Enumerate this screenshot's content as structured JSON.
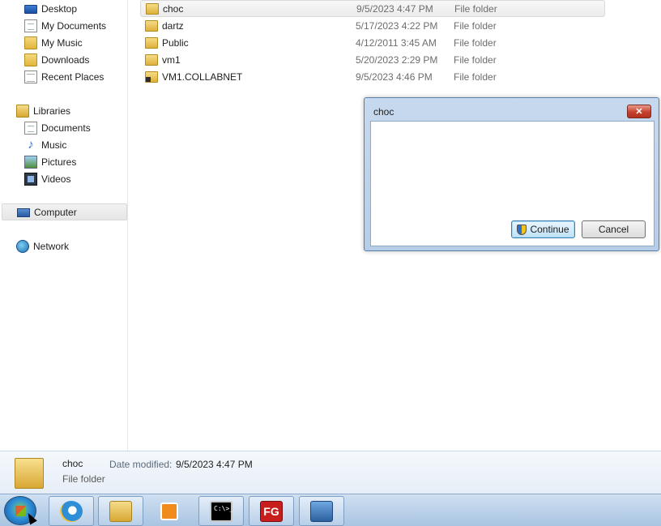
{
  "nav": {
    "favorites": [
      {
        "label": "Desktop",
        "icon": "desktop-icon"
      },
      {
        "label": "My Documents",
        "icon": "documents-library-icon"
      },
      {
        "label": "My Music",
        "icon": "music-library-icon"
      },
      {
        "label": "Downloads",
        "icon": "downloads-folder-icon"
      },
      {
        "label": "Recent Places",
        "icon": "recent-places-icon"
      }
    ],
    "libraries_label": "Libraries",
    "libraries": [
      {
        "label": "Documents",
        "icon": "documents-icon"
      },
      {
        "label": "Music",
        "icon": "music-icon"
      },
      {
        "label": "Pictures",
        "icon": "pictures-icon"
      },
      {
        "label": "Videos",
        "icon": "videos-icon"
      }
    ],
    "computer_label": "Computer",
    "network_label": "Network"
  },
  "files": [
    {
      "name": "choc",
      "date": "9/5/2023 4:47 PM",
      "type": "File folder",
      "selected": true
    },
    {
      "name": "dartz",
      "date": "5/17/2023 4:22 PM",
      "type": "File folder"
    },
    {
      "name": "Public",
      "date": "4/12/2011 3:45 AM",
      "type": "File folder"
    },
    {
      "name": "vm1",
      "date": "5/20/2023 2:29 PM",
      "type": "File folder"
    },
    {
      "name": "VM1.COLLABNET",
      "date": "9/5/2023 4:46 PM",
      "type": "File folder",
      "locked": true
    }
  ],
  "details": {
    "name": "choc",
    "type": "File folder",
    "date_label": "Date modified:",
    "date_value": "9/5/2023 4:47 PM"
  },
  "dialog": {
    "title": "choc",
    "close_icon": "close-icon",
    "continue_label": "Continue",
    "cancel_label": "Cancel"
  },
  "taskbar": {
    "fg_label": "FG",
    "cmd_label": "C:\\>_",
    "items": [
      "start-orb",
      "internet-explorer",
      "windows-explorer",
      "media-player",
      "command-prompt",
      "fg-app",
      "remote-desktop"
    ]
  },
  "colors": {
    "selection": "#ececec",
    "taskbar": "#b8cfe8",
    "dialog_frame": "#c7d9ee",
    "close_button": "#c6402d",
    "primary_button": "#bfe1f7"
  }
}
